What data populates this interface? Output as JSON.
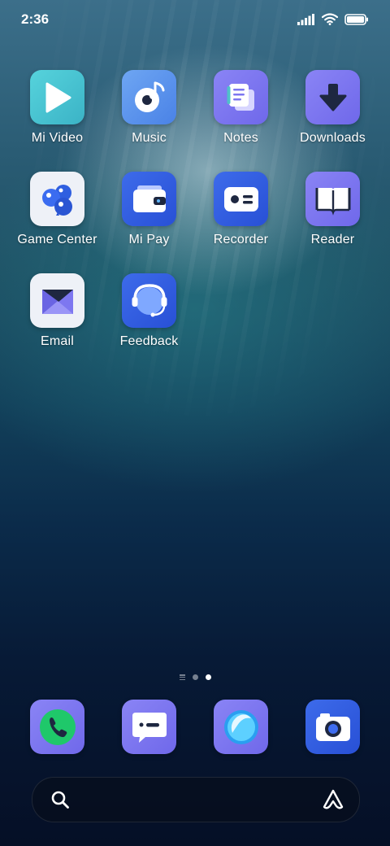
{
  "status_bar": {
    "time": "2:36",
    "icons": [
      "signal-icon",
      "wifi-icon",
      "battery-icon"
    ]
  },
  "apps": [
    {
      "label": "Mi Video",
      "icon": "play-icon",
      "color": "#46c6d2"
    },
    {
      "label": "Music",
      "icon": "music-disc-icon",
      "color": "#5c92ee"
    },
    {
      "label": "Notes",
      "icon": "notes-icon",
      "color": "#7d77f0"
    },
    {
      "label": "Downloads",
      "icon": "download-arrow-icon",
      "color": "#7d77f0"
    },
    {
      "label": "Game Center",
      "icon": "game-bubbles-icon",
      "color": "#e9edf5"
    },
    {
      "label": "Mi Pay",
      "icon": "wallet-icon",
      "color": "#2f5fe0"
    },
    {
      "label": "Recorder",
      "icon": "recorder-icon",
      "color": "#2f5fe0"
    },
    {
      "label": "Reader",
      "icon": "book-icon",
      "color": "#7d77f0"
    },
    {
      "label": "Email",
      "icon": "envelope-icon",
      "color": "#e9edf5"
    },
    {
      "label": "Feedback",
      "icon": "headset-icon",
      "color": "#2f5fe0"
    }
  ],
  "page_indicator": {
    "pages": 2,
    "current": 2
  },
  "dock": [
    {
      "name": "phone",
      "icon": "phone-icon",
      "color": "#7d77f0"
    },
    {
      "name": "messages",
      "icon": "message-bubble-icon",
      "color": "#7d77f0"
    },
    {
      "name": "browser",
      "icon": "browser-orb-icon",
      "color": "#7d77f0"
    },
    {
      "name": "camera",
      "icon": "camera-icon",
      "color": "#2f5fe0"
    }
  ],
  "search_bar": {
    "left_icon": "search-icon",
    "right_icon": "assistant-icon"
  }
}
